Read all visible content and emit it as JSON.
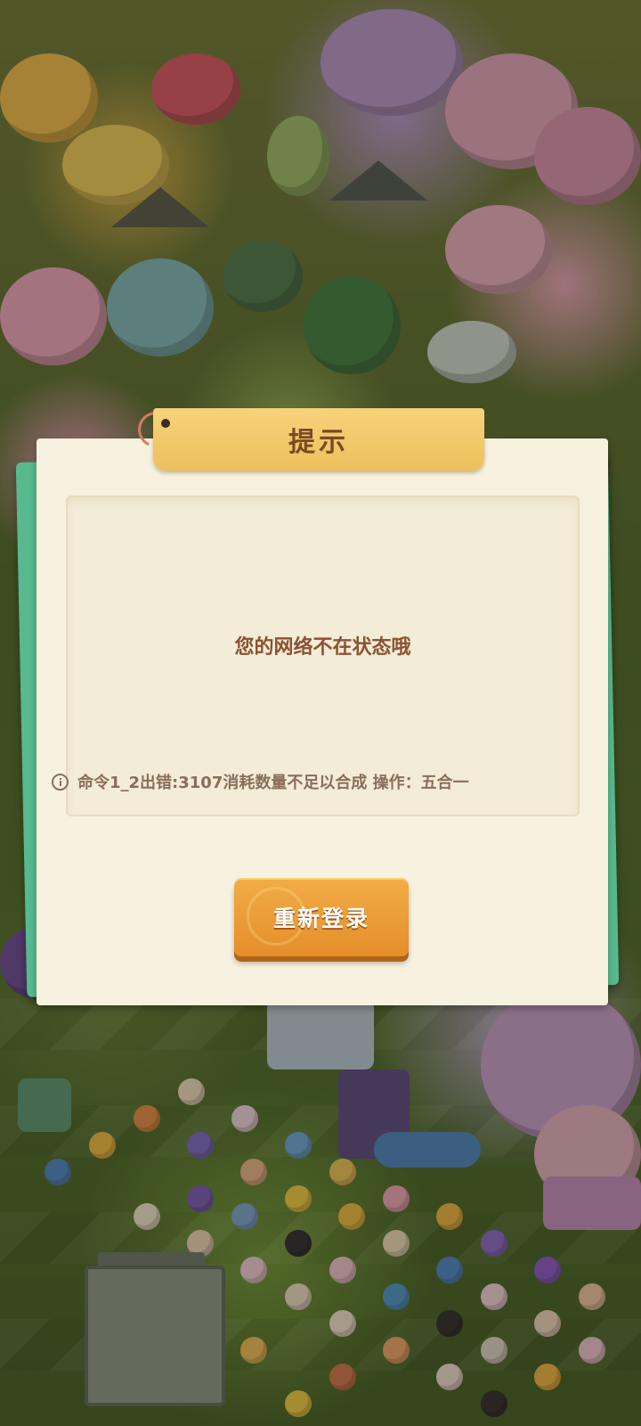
{
  "dialog": {
    "title": "提示",
    "message": "您的网络不在状态哦",
    "error_text": "命令1_2出错:3107消耗数量不足以合成  操作：五合一",
    "error_icon": "info-icon",
    "button_label": "重新登录"
  },
  "colors": {
    "dialog_bg": "#f7f1df",
    "dialog_back": "#58b98e",
    "title_tab": "#eebf5c",
    "title_text": "#7a4a26",
    "message_text": "#8b5232",
    "error_text": "#8a6e5a",
    "button": "#e48e2a"
  }
}
